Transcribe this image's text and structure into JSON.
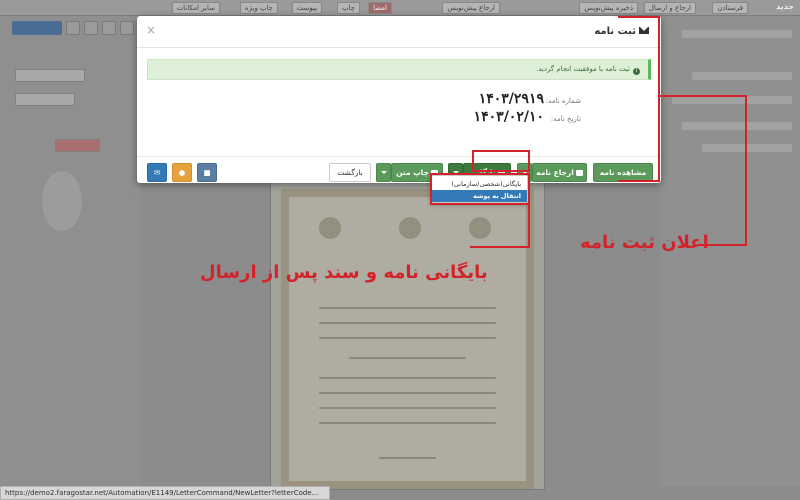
{
  "app": {
    "brand": "جدید",
    "topbar_buttons": [
      "فرستادن",
      "ارجاع پیش‌نویس",
      "ذخیره پیش‌نویس",
      "ارجاع و ارسال",
      "امضا",
      "چاپ",
      "پیوست",
      "چاپ ویژه",
      "سایر امکانات"
    ]
  },
  "modal": {
    "title": "ثبت نامه",
    "alert_text": "ثبت نامه با موفقیت انجام گردید.",
    "letter_number_label": "شماره نامه:",
    "letter_number": "۱۴۰۳/۲۹۱۹",
    "letter_date_label": "تاریخ نامه:",
    "letter_date": "۱۴۰۳/۰۲/۱۰",
    "buttons": {
      "view_letter": "مشاهده نامه",
      "refer_letter": "ارجاع نامه",
      "archive": "بایگانی",
      "print_text": "چاپ متن",
      "back": "بازگشت"
    },
    "dropdown": [
      {
        "label": "بایگانی(شخصی/سازمانی)"
      },
      {
        "label": "انتقال به پوشه"
      }
    ]
  },
  "annotations": {
    "archive_label": "بایگانی نامه و سند پس از ارسال",
    "register_label": "اعلان ثبت نامه"
  },
  "statusbar": {
    "url": "https://demo2.faragostar.net/Automation/E1149/LetterCommand/NewLetter?letterCode..."
  },
  "colors": {
    "green": "#5b9a5b",
    "dark_green": "#3e7a3e",
    "blue": "#337ab7",
    "orange": "#e6a23c",
    "annotation_red": "#d3232a"
  }
}
